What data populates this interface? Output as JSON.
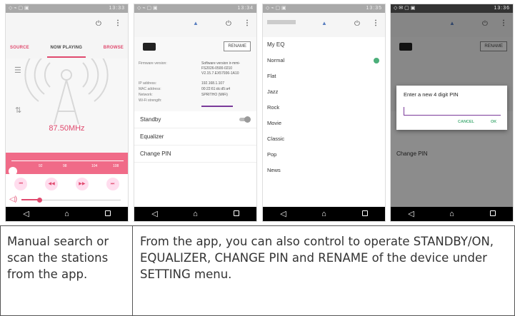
{
  "phone1": {
    "status_time": "13:33",
    "tabs": [
      "SOURCE",
      "NOW PLAYING",
      "BROWSE"
    ],
    "frequency": "87.50MHz",
    "tuner_ticks": [
      "92",
      "98",
      "104",
      "108"
    ],
    "tuner_level": 0.0,
    "volume_level": 0.2,
    "colors": {
      "accent": "#e04a6e",
      "tuner_bg": "#f06b88"
    },
    "icons": [
      "power-icon",
      "more-vert-icon",
      "list-icon",
      "radio-tower-icon",
      "prev-icon",
      "rewind-icon",
      "forward-icon",
      "next-icon",
      "volume-icon"
    ]
  },
  "phone2": {
    "status_time": "13:34",
    "rename_label": "RENAME",
    "info": [
      {
        "label": "Firmware version:",
        "value": "Software version ir-mmi-FS2026-0500-0210 V2.15.7.EX57936-1A10"
      },
      {
        "label": "IP address:",
        "value": "192.168.1.107"
      },
      {
        "label": "MAC address:",
        "value": "00:22:61:dc:d5:a4"
      },
      {
        "label": "Network:",
        "value": "SPRITHO (WiFi)"
      },
      {
        "label": "Wi-Fi strength:",
        "value": ""
      }
    ],
    "menu": [
      "Standby",
      "Equalizer",
      "Change PIN"
    ]
  },
  "phone3": {
    "status_time": "13:35",
    "eq_title": "My EQ",
    "eq_items": [
      "Normal",
      "Flat",
      "Jazz",
      "Rock",
      "Movie",
      "Classic",
      "Pop",
      "News"
    ],
    "selected": "Normal"
  },
  "phone4": {
    "status_time": "13:36",
    "rename_label": "RENAME",
    "dialog_title": "Enter a new 4 digit PIN",
    "cancel_label": "CANCEL",
    "ok_label": "OK",
    "menu_visible": "Change PIN"
  },
  "captions": {
    "left": "Manual search or scan the stations from the app.",
    "right": "From the app, you can also control to operate STANDBY/ON, EQUALIZER, CHANGE PIN and RENAME of the device under SETTING menu."
  }
}
